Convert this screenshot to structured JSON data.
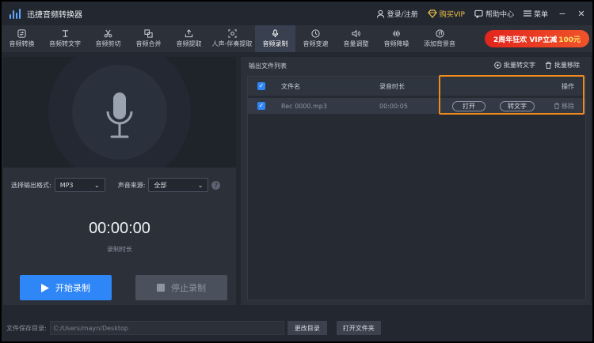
{
  "app": {
    "title": "迅捷音频转换器"
  },
  "titlebar": {
    "login": "登录/注册",
    "buy_vip": "购买VIP",
    "help": "帮助中心",
    "menu": "菜单",
    "minimize": "−",
    "close": "✕"
  },
  "toolbar": {
    "items": [
      {
        "label": "音频转换",
        "icon": "convert-icon"
      },
      {
        "label": "音频转文字",
        "icon": "audio-text-icon"
      },
      {
        "label": "音频剪切",
        "icon": "scissors-icon"
      },
      {
        "label": "音频合并",
        "icon": "merge-icon"
      },
      {
        "label": "音频提取",
        "icon": "extract-icon"
      },
      {
        "label": "人声-伴奏提取",
        "icon": "vocal-icon"
      },
      {
        "label": "音频录制",
        "icon": "mic-icon"
      },
      {
        "label": "音频变速",
        "icon": "speed-icon"
      },
      {
        "label": "音量调整",
        "icon": "volume-icon"
      },
      {
        "label": "音频降噪",
        "icon": "denoise-icon"
      },
      {
        "label": "添加背景音",
        "icon": "bgm-icon"
      }
    ],
    "active_index": 6,
    "promo": {
      "text": "2周年狂欢 VIP立减",
      "amount": "100元"
    }
  },
  "recorder": {
    "format_label": "选择输出格式:",
    "format_value": "MP3",
    "source_label": "声音来源:",
    "source_value": "全部",
    "help": "?",
    "timer": "00:00:00",
    "timer_label": "录制时长",
    "start_label": "开始录制",
    "stop_label": "停止录制"
  },
  "output": {
    "title": "输出文件列表",
    "batch_text": "批量转文字",
    "batch_remove": "批量移除",
    "columns": {
      "name": "文件名",
      "duration": "录音时长",
      "ops": "操作"
    },
    "rows": [
      {
        "name": "Rec 0000.mp3",
        "duration": "00:00:05",
        "open": "打开",
        "to_text": "转文字",
        "remove": "移除"
      }
    ]
  },
  "footer": {
    "save_dir_label": "文件保存目录:",
    "save_dir_value": "C:/Users/mayn/Desktop",
    "change_dir": "更改目录",
    "open_folder": "打开文件夹"
  },
  "colors": {
    "accent": "#2f86f6",
    "highlight": "#f08a1c",
    "vip": "#f2c14e",
    "promo": "#e2251c"
  }
}
